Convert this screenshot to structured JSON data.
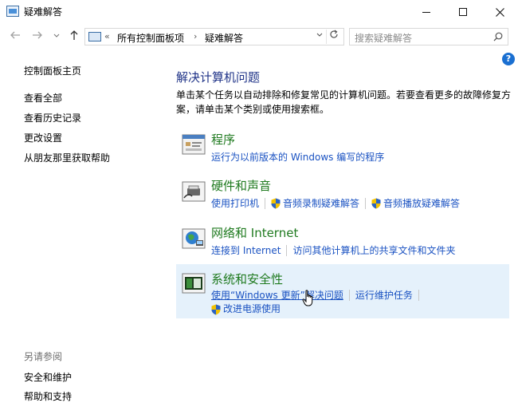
{
  "window": {
    "title": "疑难解答",
    "colors": {
      "link": "#1a52c2",
      "category_title": "#1f7a1f",
      "heading": "#1e3287",
      "highlight": "#e5f1fb"
    }
  },
  "nav": {
    "breadcrumb_root_chevron": "«",
    "breadcrumb": [
      "所有控制面板项",
      "疑难解答"
    ],
    "breadcrumb_sep": "›",
    "search_placeholder": "搜索疑难解答"
  },
  "sidebar": {
    "items": [
      {
        "label": "控制面板主页"
      },
      {
        "label": "查看全部"
      },
      {
        "label": "查看历史记录"
      },
      {
        "label": "更改设置"
      },
      {
        "label": "从朋友那里获取帮助"
      }
    ],
    "see_also_title": "另请参阅",
    "see_also": [
      {
        "label": "安全和维护"
      },
      {
        "label": "帮助和支持"
      }
    ]
  },
  "main": {
    "title": "解决计算机问题",
    "description": "单击某个任务以自动排除和修复常见的计算机问题。若要查看更多的故障修复方案，请单击某个类别或使用搜索框。",
    "categories": [
      {
        "title": "程序",
        "icon": "programs-icon",
        "links": [
          "运行为以前版本的 Windows 编写的程序"
        ]
      },
      {
        "title": "硬件和声音",
        "icon": "hardware-sound-icon",
        "links": [
          "使用打印机",
          "音频录制疑难解答",
          "音频播放疑难解答"
        ]
      },
      {
        "title": "网络和 Internet",
        "icon": "network-icon",
        "links": [
          "连接到 Internet",
          "访问其他计算机上的共享文件和文件夹"
        ]
      },
      {
        "title": "系统和安全性",
        "icon": "system-security-icon",
        "links": [
          "使用“Windows 更新”解决问题",
          "运行维护任务",
          "改进电源使用"
        ]
      }
    ]
  }
}
